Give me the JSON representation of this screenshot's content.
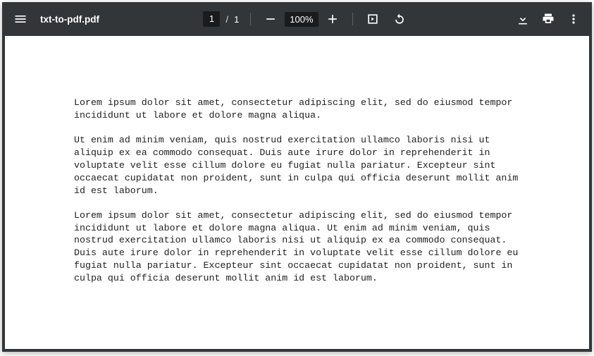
{
  "toolbar": {
    "filename": "txt-to-pdf.pdf",
    "page_current": "1",
    "page_separator": "/",
    "page_total": "1",
    "zoom_value": "100%"
  },
  "document": {
    "paragraphs": [
      "Lorem ipsum dolor sit amet, consectetur adipiscing elit, sed do eiusmod tempor incididunt ut labore et dolore magna aliqua.",
      "Ut enim ad minim veniam, quis nostrud exercitation ullamco laboris nisi ut aliquip ex ea commodo consequat. Duis aute irure dolor in reprehenderit in voluptate velit esse cillum dolore eu fugiat nulla pariatur. Excepteur sint occaecat cupidatat non proident, sunt in culpa qui officia deserunt mollit anim id est laborum.",
      "Lorem ipsum dolor sit amet, consectetur adipiscing elit, sed do eiusmod tempor incididunt ut labore et dolore magna aliqua. Ut enim ad minim veniam, quis nostrud exercitation ullamco laboris nisi ut aliquip ex ea commodo consequat. Duis aute irure dolor in reprehenderit in voluptate velit esse cillum dolore eu fugiat nulla pariatur. Excepteur sint occaecat cupidatat non proident, sunt in culpa qui officia deserunt mollit anim id est laborum."
    ]
  }
}
